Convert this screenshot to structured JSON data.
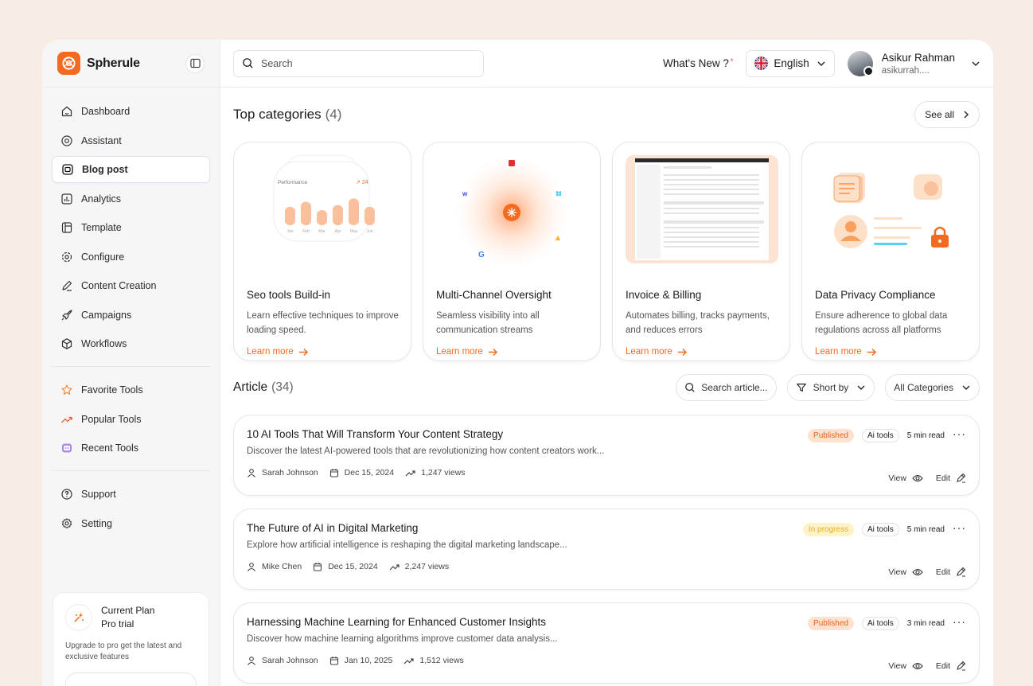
{
  "brand": {
    "name": "Spherule"
  },
  "sidebar": {
    "items": [
      {
        "label": "Dashboard",
        "icon": "home-icon"
      },
      {
        "label": "Assistant",
        "icon": "assistant-icon"
      },
      {
        "label": "Blog post",
        "icon": "blog-icon",
        "active": true
      },
      {
        "label": "Analytics",
        "icon": "analytics-icon"
      },
      {
        "label": "Template",
        "icon": "template-icon"
      },
      {
        "label": "Configure",
        "icon": "configure-icon"
      },
      {
        "label": "Content Creation",
        "icon": "pen-icon"
      },
      {
        "label": "Campaigns",
        "icon": "rocket-icon"
      },
      {
        "label": "Workflows",
        "icon": "box-icon"
      }
    ],
    "tools": [
      {
        "label": "Favorite Tools",
        "icon": "star-icon"
      },
      {
        "label": "Popular Tools",
        "icon": "trending-icon"
      },
      {
        "label": "Recent Tools",
        "icon": "recent-icon"
      }
    ],
    "bottom": [
      {
        "label": "Support",
        "icon": "help-icon"
      },
      {
        "label": "Setting",
        "icon": "gear-icon"
      }
    ],
    "plan": {
      "label": "Current Plan",
      "name": "Pro trial",
      "description": "Upgrade to pro get the latest and exclusive features"
    }
  },
  "header": {
    "search_placeholder": "Search",
    "whats_new": "What's New ?",
    "language": "English",
    "user_name": "Asikur Rahman",
    "user_email": "asikurrah...."
  },
  "categories": {
    "title": "Top categories",
    "count": "(4)",
    "see_all": "See all",
    "items": [
      {
        "title": "Seo tools Build-in",
        "desc": "Learn effective techniques to improve loading speed.",
        "link": "Learn more",
        "chart_label": "Performance",
        "chart_badge": "24",
        "months": [
          "Jan",
          "Feb",
          "Mar",
          "Apr",
          "May",
          "Jun"
        ],
        "bars": [
          0.55,
          0.7,
          0.45,
          0.6,
          0.8,
          0.55
        ]
      },
      {
        "title": "Multi-Channel Oversight",
        "desc": "Seamless visibility into all communication streams",
        "link": "Learn more"
      },
      {
        "title": "Invoice & Billing",
        "desc": "Automates billing, tracks payments, and reduces errors",
        "link": "Learn more"
      },
      {
        "title": "Data Privacy Compliance",
        "desc": "Ensure adherence to global data regulations across all platforms",
        "link": "Learn more"
      }
    ]
  },
  "articles_section": {
    "title": "Article",
    "count": "(34)",
    "search_placeholder": "Search article...",
    "sort_label": "Short by",
    "category_label": "All Categories"
  },
  "articles": [
    {
      "title": "10 AI Tools That Will Transform Your Content Strategy",
      "desc": "Discover the latest AI-powered tools that are revolutionizing how content creators work...",
      "status": "Published",
      "tag": "Ai tools",
      "read": "5 min read",
      "author": "Sarah Johnson",
      "date": "Dec 15, 2024",
      "views": "1,247 views",
      "view": "View",
      "edit": "Edit"
    },
    {
      "title": "The Future of AI in Digital Marketing",
      "desc": "Explore how artificial intelligence is reshaping the digital marketing landscape...",
      "status": "In progress",
      "tag": "Ai tools",
      "read": "5 min read",
      "author": "Mike Chen",
      "date": "Dec 15, 2024",
      "views": "2,247 views",
      "view": "View",
      "edit": "Edit"
    },
    {
      "title": "Harnessing Machine Learning for Enhanced Customer Insights",
      "desc": "Discover how machine learning algorithms improve customer data analysis...",
      "status": "Published",
      "tag": "Ai tools",
      "read": "3 min read",
      "author": "Sarah Johnson",
      "date": "Jan 10, 2025",
      "views": "1,512 views",
      "view": "View",
      "edit": "Edit"
    }
  ],
  "colors": {
    "accent": "#f26b21",
    "published_bg": "#fde2d2",
    "progress_bg": "#fdf3c6"
  }
}
